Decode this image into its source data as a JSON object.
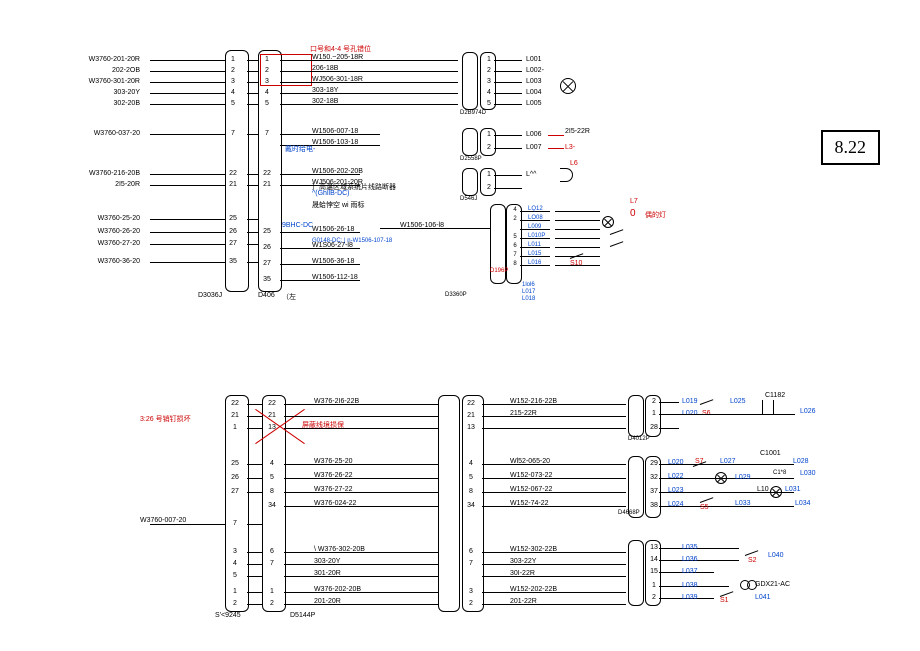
{
  "page_number": "8.22",
  "top": {
    "left_connector": {
      "label": "D3036J",
      "pins": [
        {
          "n": "1",
          "left": "W3760-201-20R",
          "right": ""
        },
        {
          "n": "2",
          "left": "202-2OB",
          "right": ""
        },
        {
          "n": "3",
          "left": "W3760-301-20R",
          "right": ""
        },
        {
          "n": "4",
          "left": "303-20Y",
          "right": ""
        },
        {
          "n": "5",
          "left": "302-20B",
          "right": ""
        },
        {
          "n": "7",
          "left": "W3760-037-20",
          "right": ""
        },
        {
          "n": "22",
          "left": "W3760-216-20B",
          "right": ""
        },
        {
          "n": "21",
          "left": "2I5-20R",
          "right": ""
        },
        {
          "n": "25",
          "left": "W3760-25-20",
          "right": ""
        },
        {
          "n": "26",
          "left": "W3760-26-20",
          "right": ""
        },
        {
          "n": "27",
          "left": "W3760-27-20",
          "right": ""
        },
        {
          "n": "35",
          "left": "W3760-36-20",
          "right": ""
        }
      ]
    },
    "mid_connector": {
      "label": "D406",
      "note_top": "口号和4-4 号孔错位",
      "note_le": "（左",
      "pins": [
        {
          "n": "1",
          "right": "W150.~205-18R"
        },
        {
          "n": "2",
          "right": "206-18B"
        },
        {
          "n": "3",
          "right": "WJ506-301-18R"
        },
        {
          "n": "4",
          "right": "303-18Y"
        },
        {
          "n": "5",
          "right": "302-18B"
        },
        {
          "n": "7",
          "right": "W1506-007-18"
        },
        {
          "n": "",
          "right": "W1506-103-18"
        },
        {
          "n": "22",
          "right": "W1506-202-20B"
        },
        {
          "n": "21",
          "right": "WJ506-201-20R"
        },
        {
          "n": "25",
          "right": "W1506-26-18"
        },
        {
          "n": "26",
          "right": "W1S06-27-l8"
        },
        {
          "n": "27",
          "right": "W1506-36-18"
        },
        {
          "n": "35",
          "right": "W1506-112-18"
        }
      ],
      "annotations": {
        "mid1": "戴时给电-",
        "mid2": "〕高温区域系统片线路断器",
        "mid3": "^(GhllB-DC)",
        "mid4": "晟蛤悖空 wi 雨标",
        "mid5": "9BHC-DC",
        "mid6": "G0148-DC; | n-W1506-107-18"
      }
    },
    "right_block1": {
      "label": "D2B974D",
      "pins": [
        {
          "n": "1",
          "r": "L001"
        },
        {
          "n": "2",
          "r": "L002-"
        },
        {
          "n": "3",
          "r": "L003"
        },
        {
          "n": "4",
          "r": "L004"
        },
        {
          "n": "5",
          "r": "L005"
        }
      ]
    },
    "right_block2": {
      "label": "D2558P",
      "pins": [
        {
          "n": "1",
          "r": "L006",
          "extra": "2I5-22R"
        },
        {
          "n": "2",
          "r": "L007",
          "extra": "L3-"
        }
      ]
    },
    "right_block3": {
      "label": "D546J",
      "pins": [
        {
          "n": "1",
          "r": "L^^"
        },
        {
          "n": "2",
          "r": ""
        }
      ],
      "note": "L6"
    },
    "right_block4": {
      "label": "D196P",
      "label2": "D3360P",
      "pre": "W1506-106-l8",
      "pins": [
        {
          "n": "4",
          "r": "LQ12"
        },
        {
          "n": "2",
          "r": "LO08"
        },
        {
          "n": "",
          "r": "L009"
        },
        {
          "n": "5",
          "r": "L010P"
        },
        {
          "n": "6",
          "r": "L011"
        },
        {
          "n": "7",
          "r": "L015"
        },
        {
          "n": "8",
          "r": "L016"
        }
      ],
      "extra": [
        "S10",
        "1lol6",
        "L017",
        "L018"
      ],
      "lamp_note": "偶的灯",
      "lamp_zero": "0",
      "L7": "L7"
    }
  },
  "bottom": {
    "left_connector": {
      "label": "S'<9245",
      "note": "3:26 号销钉损坏",
      "pins": [
        {
          "n": "22"
        },
        {
          "n": "21"
        },
        {
          "n": "1"
        },
        {
          "n": "25"
        },
        {
          "n": "26"
        },
        {
          "n": "27"
        },
        {
          "n": "7",
          "left": "W3760-007-20"
        },
        {
          "n": "3"
        },
        {
          "n": "4"
        },
        {
          "n": "5"
        },
        {
          "n": "1"
        },
        {
          "n": "2"
        }
      ]
    },
    "mid_connector": {
      "label": "D5144P",
      "note": "屏蔽线境损保",
      "pins": [
        {
          "n": "22",
          "r": "W376-2I6-22B"
        },
        {
          "n": "21",
          "r": ""
        },
        {
          "n": "13",
          "r": ""
        },
        {
          "n": "4",
          "r": "W376-25-20"
        },
        {
          "n": "5",
          "r": "W376-26-22"
        },
        {
          "n": "8",
          "r": "W376-27-22"
        },
        {
          "n": "34",
          "r": "W376-024-22"
        },
        {
          "n": "6",
          "r": "\\ W376-302-20B"
        },
        {
          "n": "7",
          "r": "303-20Y"
        },
        {
          "n": "",
          "r": "301-20R"
        },
        {
          "n": "1",
          "r": "W376-202-20B"
        },
        {
          "n": "2",
          "r": "201-20R"
        }
      ]
    },
    "mid2_connector": {
      "pins": [
        {
          "n": "22",
          "r": "W152-216-22B"
        },
        {
          "n": "21",
          "r": "215-22R"
        },
        {
          "n": "13",
          "r": ""
        },
        {
          "n": "4",
          "r": "Wl52-065-20"
        },
        {
          "n": "5",
          "r": "W152-073-22"
        },
        {
          "n": "8",
          "r": "W152-067-22"
        },
        {
          "n": "34",
          "r": "W152-74-22"
        },
        {
          "n": "6",
          "r": "W152-302-22B"
        },
        {
          "n": "7",
          "r": "303-22Y"
        },
        {
          "n": "",
          "r": "30I-22R"
        },
        {
          "n": "3",
          "r": "W152-202-22B"
        },
        {
          "n": "2",
          "r": "201-22R"
        }
      ]
    },
    "right_block1": {
      "label": "D4012P",
      "pins": [
        {
          "n": "2",
          "r": "L019"
        },
        {
          "n": "1",
          "r": "L020"
        },
        {
          "n": "28",
          "r": ""
        }
      ],
      "extra": [
        "S6",
        "L025",
        "C1182",
        "L026"
      ]
    },
    "right_block2": {
      "label": "D4668P",
      "pins": [
        {
          "n": "29",
          "r": "L020"
        },
        {
          "n": "32",
          "r": "L022"
        },
        {
          "n": "37",
          "r": "L023"
        },
        {
          "n": "38",
          "r": "L024"
        }
      ],
      "extra": [
        "S7",
        "L027",
        "C1001",
        "L028",
        "L029",
        "C1*8",
        "L030",
        "L10",
        "L031",
        "S5",
        "L033",
        "L034"
      ]
    },
    "right_block3": {
      "pins": [
        {
          "n": "13",
          "r": "L035"
        },
        {
          "n": "14",
          "r": "L036"
        },
        {
          "n": "15",
          "r": "L037"
        },
        {
          "n": "1",
          "r": "L038"
        },
        {
          "n": "2",
          "r": "L039"
        }
      ],
      "extra": [
        "S2",
        "L040",
        "GDX21-AC",
        "S1",
        "L041"
      ]
    }
  }
}
